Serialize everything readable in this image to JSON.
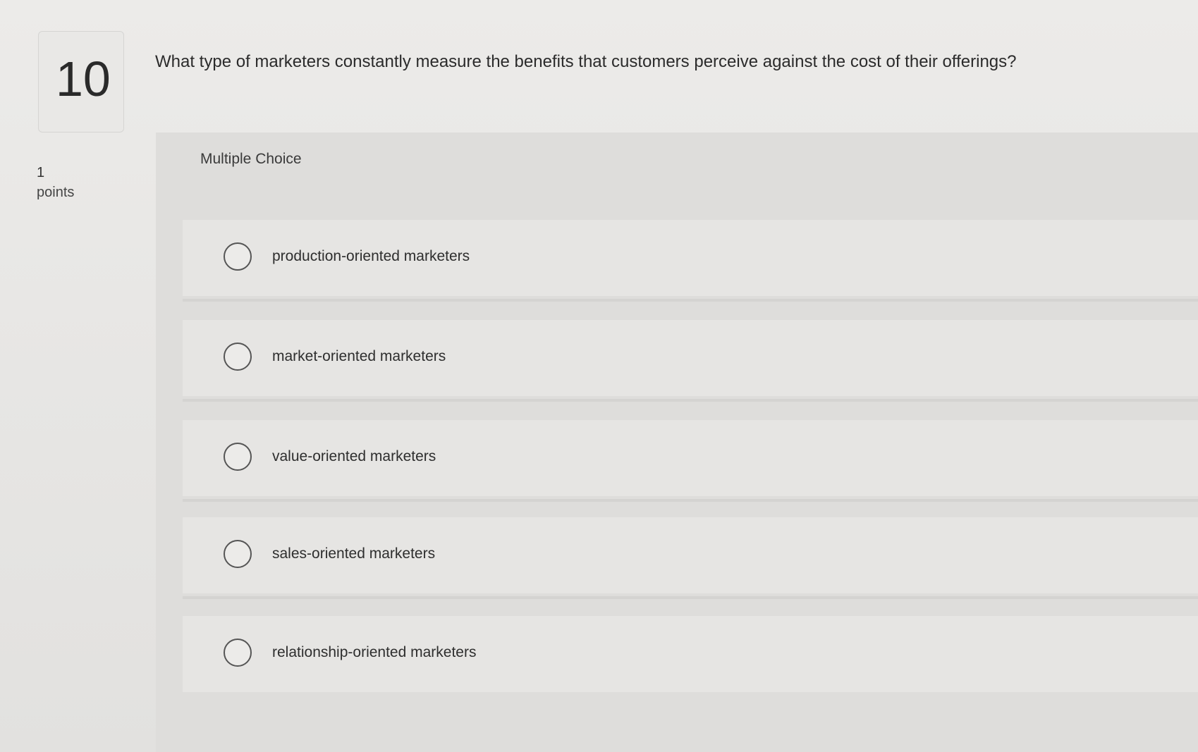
{
  "question": {
    "number": "10",
    "points_value": "1",
    "points_label": "points",
    "text": "What type of marketers constantly measure the benefits that customers perceive against the cost of their offerings?",
    "type_label": "Multiple Choice"
  },
  "options": [
    {
      "label": "production-oriented marketers",
      "selected": false
    },
    {
      "label": "market-oriented marketers",
      "selected": false
    },
    {
      "label": "value-oriented marketers",
      "selected": false
    },
    {
      "label": "sales-oriented marketers",
      "selected": false
    },
    {
      "label": "relationship-oriented marketers",
      "selected": false
    }
  ],
  "colors": {
    "background": "#e8e8e6",
    "panel": "#dedddb",
    "option_row": "#e6e5e3",
    "text": "#2e2e2e"
  }
}
